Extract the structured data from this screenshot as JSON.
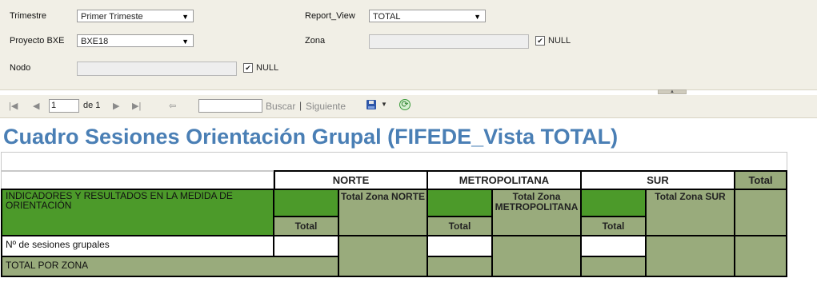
{
  "params": {
    "trimestre": {
      "label": "Trimestre",
      "value": "Primer Trimeste"
    },
    "proyecto": {
      "label": "Proyecto BXE",
      "value": "BXE18"
    },
    "nodo": {
      "label": "Nodo",
      "null_label": "NULL"
    },
    "report_view": {
      "label": "Report_View",
      "value": "TOTAL"
    },
    "zona": {
      "label": "Zona",
      "null_label": "NULL"
    }
  },
  "toolbar": {
    "page_value": "1",
    "page_of": "de 1",
    "buscar": "Buscar",
    "separator": "|",
    "siguiente": "Siguiente"
  },
  "report": {
    "title": "Cuadro Sesiones Orientación Grupal (FIFEDE_Vista TOTAL)",
    "headers": {
      "norte": "NORTE",
      "metropolitana": "METROPOLITANA",
      "sur": "SUR",
      "total": "Total"
    },
    "indicator_header": "INDICADORES Y RESULTADOS EN LA MEDIDA DE ORIENTACIÓN",
    "total_zona_norte": "Total Zona NORTE",
    "total_zona_metro": "Total Zona METROPOLITANA",
    "total_zona_sur": "Total Zona SUR",
    "sub_total": "Total",
    "rows": {
      "sesiones": "Nº de sesiones grupales",
      "total_por_zona": "TOTAL POR ZONA"
    }
  },
  "colors": {
    "title": "#4a7fb5",
    "dark_green": "#4c9a2a",
    "olive": "#99ab7c",
    "param_bg": "#f1efe6"
  }
}
